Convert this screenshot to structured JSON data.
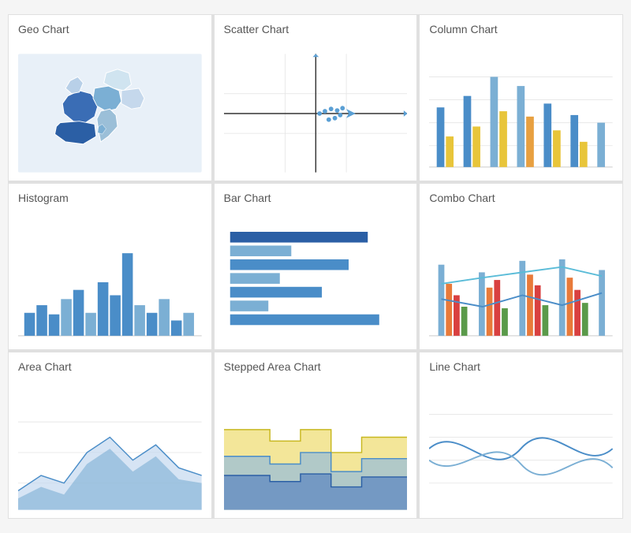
{
  "cards": [
    {
      "id": "geo-chart",
      "title": "Geo Chart"
    },
    {
      "id": "scatter-chart",
      "title": "Scatter Chart"
    },
    {
      "id": "column-chart",
      "title": "Column Chart"
    },
    {
      "id": "histogram",
      "title": "Histogram"
    },
    {
      "id": "bar-chart",
      "title": "Bar Chart"
    },
    {
      "id": "combo-chart",
      "title": "Combo Chart"
    },
    {
      "id": "area-chart",
      "title": "Area Chart"
    },
    {
      "id": "stepped-area-chart",
      "title": "Stepped Area Chart"
    },
    {
      "id": "line-chart",
      "title": "Line Chart"
    }
  ],
  "colors": {
    "blue_light": "#7bafd4",
    "blue_medium": "#4a8dc8",
    "blue_dark": "#2b5fa5",
    "yellow": "#e8c53a",
    "orange": "#e8953a",
    "red": "#d94040",
    "green": "#5a9a4a",
    "teal": "#5abcd8"
  }
}
